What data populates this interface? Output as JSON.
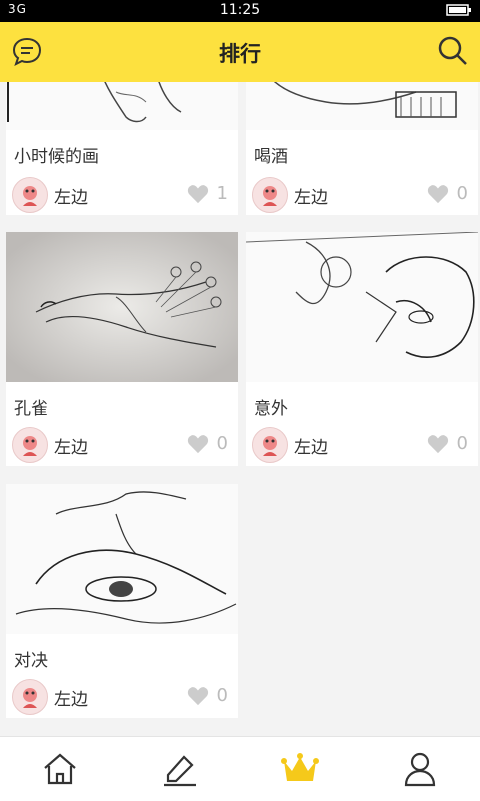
{
  "status": {
    "left_text": "3G",
    "time": "11:25"
  },
  "header": {
    "title": "排行"
  },
  "cards": [
    {
      "title": "小时候的画",
      "user": "左边",
      "likes": "1"
    },
    {
      "title": "喝酒",
      "user": "左边",
      "likes": "0"
    },
    {
      "title": "孔雀",
      "user": "左边",
      "likes": "0"
    },
    {
      "title": "意外",
      "user": "左边",
      "likes": "0"
    },
    {
      "title": "对决",
      "user": "左边",
      "likes": "0"
    }
  ],
  "tabs": [
    "home-icon",
    "draw-icon",
    "crown-icon",
    "profile-icon"
  ],
  "colors": {
    "accent": "#fde13f",
    "active_tab": "#f5c91a"
  }
}
